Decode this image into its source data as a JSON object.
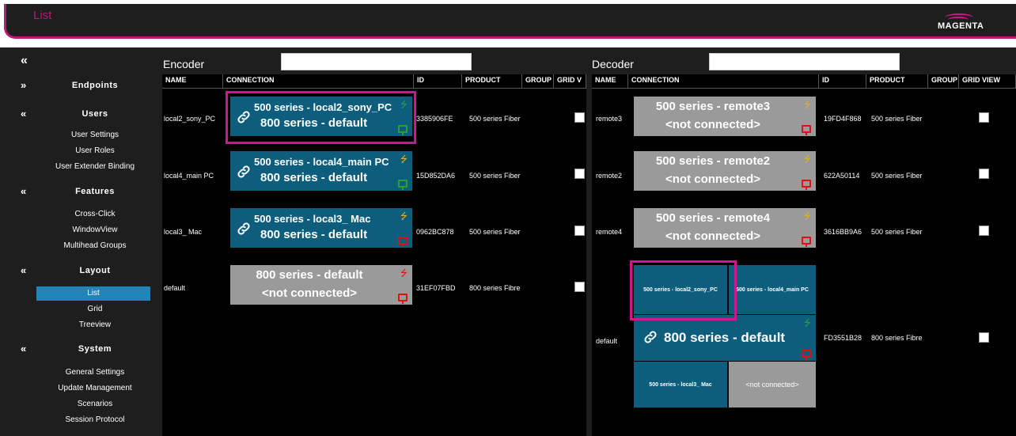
{
  "header": {
    "title": "List",
    "logo_text": "MAGENTA"
  },
  "sidebar": {
    "sections": [
      {
        "label": "Endpoints"
      },
      {
        "label": "Users",
        "items": [
          "User Settings",
          "User Roles",
          "User Extender Binding"
        ]
      },
      {
        "label": "Features",
        "items": [
          "Cross-Click",
          "WindowView",
          "Multihead Groups"
        ]
      },
      {
        "label": "Layout",
        "items": [
          "List",
          "Grid",
          "Treeview"
        ]
      },
      {
        "label": "System",
        "items": [
          "General Settings",
          "Update Management",
          "Scenarios",
          "Session Protocol"
        ]
      }
    ]
  },
  "encoder": {
    "label": "Encoder",
    "filter_value": "",
    "columns": [
      "NAME",
      "CONNECTION",
      "ID",
      "PRODUCT",
      "GROUP",
      "GRID V"
    ],
    "rows": [
      {
        "name": "local2_sony_PC",
        "line1": "500 series - local2_sony_PC",
        "line2": "800 series - default",
        "id": "3385906FE",
        "product": "500 series Fiber"
      },
      {
        "name": "local4_main PC",
        "line1": "500 series - local4_main PC",
        "line2": "800 series - default",
        "id": "15D852DA6",
        "product": "500 series Fiber"
      },
      {
        "name": "local3_ Mac",
        "line1": "500 series - local3_ Mac",
        "line2": "800 series - default",
        "id": "0962BC878",
        "product": "500 series Fiber"
      },
      {
        "name": "default",
        "line1": "800 series - default",
        "line2": "<not connected>",
        "id": "31EF07FBD",
        "product": "800 series Fibre"
      }
    ]
  },
  "decoder": {
    "label": "Decoder",
    "filter_value": "",
    "columns": [
      "NAME",
      "CONNECTION",
      "ID",
      "PRODUCT",
      "GROUP",
      "GRID VIEW"
    ],
    "rows": [
      {
        "name": "remote3",
        "line1": "500 series - remote3",
        "line2": "<not connected>",
        "id": "19FD4F868",
        "product": "500 series Fiber"
      },
      {
        "name": "remote2",
        "line1": "500 series - remote2",
        "line2": "<not connected>",
        "id": "622A50114",
        "product": "500 series Fiber"
      },
      {
        "name": "remote4",
        "line1": "500 series - remote4",
        "line2": "<not connected>",
        "id": "3616BB9A6",
        "product": "500 series Fiber"
      },
      {
        "name": "default",
        "main": "800 series - default",
        "tiles": [
          "500 series - local2_sony_PC",
          "500 series - local4_main PC",
          "500 series - local3_ Mac",
          "<not connected>"
        ],
        "id": "FD3551B28",
        "product": "800 series Fibre"
      }
    ]
  },
  "icons": {
    "link": "link-icon",
    "usb": "usb-icon",
    "monitor": "monitor-icon"
  },
  "colors": {
    "accent": "#d0168a",
    "teal": "#0d5e7d",
    "gray": "#9a9a9a",
    "active": "#2184b8",
    "usb_connected": "#2e9e2e",
    "usb_idle": "#e0b020",
    "monitor_red": "#e01010",
    "monitor_green": "#2e9e2e"
  }
}
